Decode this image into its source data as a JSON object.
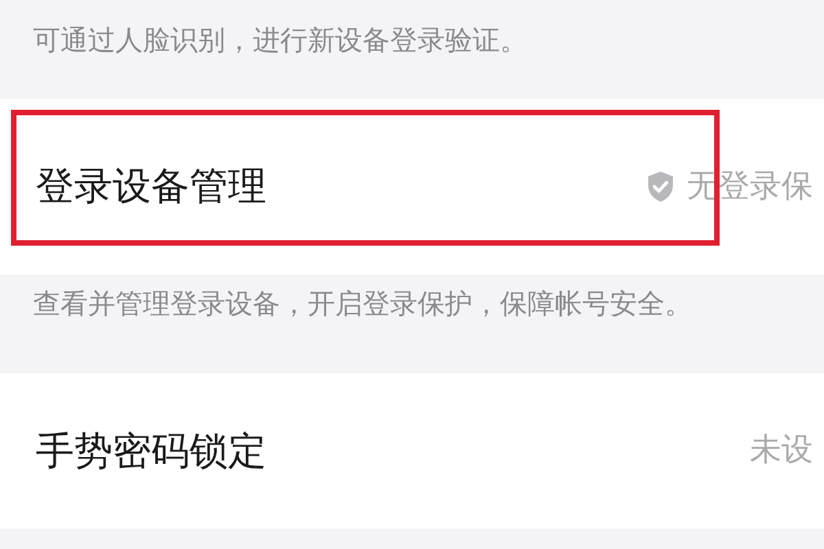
{
  "sections": [
    {
      "kind": "note",
      "text": "可通过人脸识别，进行新设备登录验证。"
    },
    {
      "kind": "row",
      "title": "登录设备管理",
      "value": "无登录保",
      "shield": true,
      "highlighted": true
    },
    {
      "kind": "note",
      "text": "查看并管理登录设备，开启登录保护，保障帐号安全。"
    },
    {
      "kind": "row",
      "title": "手势密码锁定",
      "value": "未设",
      "shield": false,
      "highlighted": false
    }
  ]
}
